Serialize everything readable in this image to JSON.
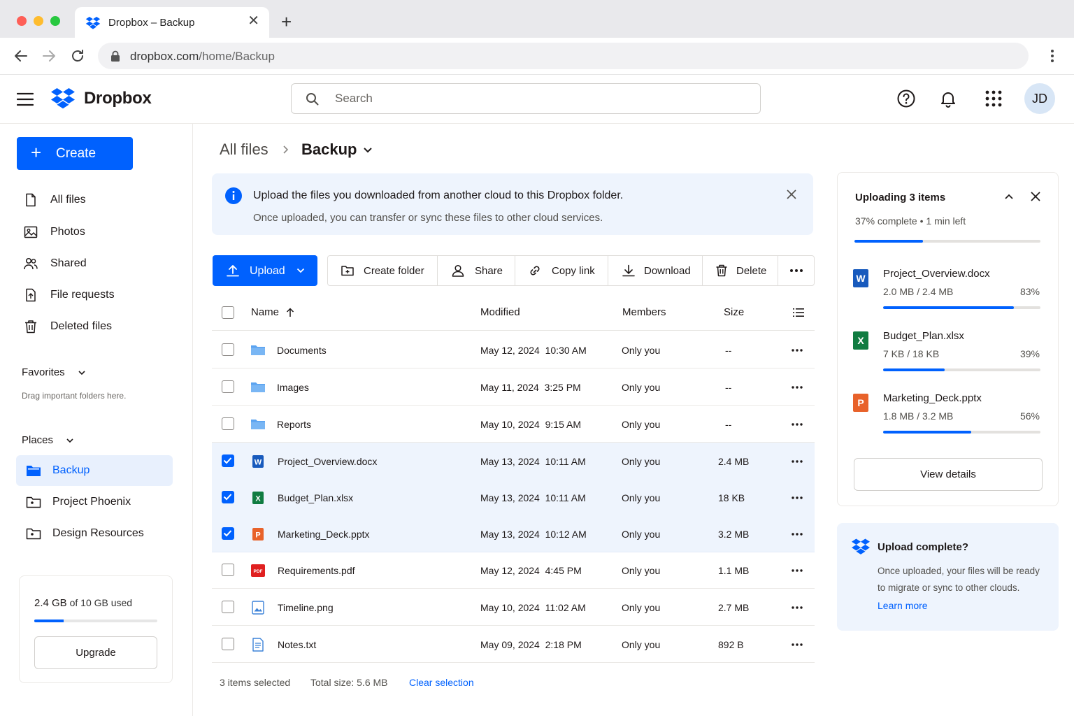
{
  "browser": {
    "tab_title": "Dropbox – Backup",
    "url_domain": "dropbox.com",
    "url_path": "/home/Backup"
  },
  "header": {
    "brand": "Dropbox",
    "search_placeholder": "Search",
    "avatar_initials": "JD"
  },
  "sidebar": {
    "create_label": "Create",
    "nav": [
      {
        "label": "All files",
        "icon": "file-icon"
      },
      {
        "label": "Photos",
        "icon": "photo-icon"
      },
      {
        "label": "Shared",
        "icon": "people-icon"
      },
      {
        "label": "File requests",
        "icon": "file-request-icon"
      },
      {
        "label": "Deleted files",
        "icon": "trash-icon"
      }
    ],
    "favorites_label": "Favorites",
    "favorites_hint": "Drag important folders here.",
    "places_label": "Places",
    "places": [
      {
        "label": "Backup",
        "active": true
      },
      {
        "label": "Project Phoenix",
        "active": false
      },
      {
        "label": "Design Resources",
        "active": false
      }
    ],
    "storage": {
      "used": "2.4 GB",
      "rest": "of 10 GB used",
      "fraction": 0.24,
      "upgrade_label": "Upgrade"
    }
  },
  "breadcrumb": {
    "root": "All files",
    "current": "Backup"
  },
  "banner": {
    "title": "Upload the files you downloaded from another cloud to this Dropbox folder.",
    "body": "Once uploaded, you can transfer or sync these files to other cloud services."
  },
  "toolbar": {
    "upload": "Upload",
    "create_folder": "Create folder",
    "share": "Share",
    "copy_link": "Copy link",
    "download": "Download",
    "delete": "Delete"
  },
  "table": {
    "columns": {
      "name": "Name",
      "modified": "Modified",
      "members": "Members",
      "size": "Size"
    },
    "rows": [
      {
        "name": "Documents",
        "type": "folder",
        "modified": "May 12, 2024  10:30 AM",
        "members": "Only you",
        "size": "--",
        "selected": false
      },
      {
        "name": "Images",
        "type": "folder",
        "modified": "May 11, 2024  3:25 PM",
        "members": "Only you",
        "size": "--",
        "selected": false
      },
      {
        "name": "Reports",
        "type": "folder",
        "modified": "May 10, 2024  9:15 AM",
        "members": "Only you",
        "size": "--",
        "selected": false
      },
      {
        "name": "Project_Overview.docx",
        "type": "word",
        "modified": "May 13, 2024  10:11 AM",
        "members": "Only you",
        "size": "2.4 MB",
        "selected": true
      },
      {
        "name": "Budget_Plan.xlsx",
        "type": "excel",
        "modified": "May 13, 2024  10:11 AM",
        "members": "Only you",
        "size": "18 KB",
        "selected": true
      },
      {
        "name": "Marketing_Deck.pptx",
        "type": "powerpoint",
        "modified": "May 13, 2024  10:12 AM",
        "members": "Only you",
        "size": "3.2 MB",
        "selected": true
      },
      {
        "name": "Requirements.pdf",
        "type": "pdf",
        "modified": "May 12, 2024  4:45 PM",
        "members": "Only you",
        "size": "1.1 MB",
        "selected": false
      },
      {
        "name": "Timeline.png",
        "type": "image",
        "modified": "May 10, 2024  11:02 AM",
        "members": "Only you",
        "size": "2.7 MB",
        "selected": false
      },
      {
        "name": "Notes.txt",
        "type": "text",
        "modified": "May 09, 2024  2:18 PM",
        "members": "Only you",
        "size": "892 B",
        "selected": false
      }
    ]
  },
  "footer": {
    "selected": "3 items selected",
    "total": "Total size:  5.6 MB",
    "clear": "Clear selection"
  },
  "upload_panel": {
    "title": "Uploading 3 items",
    "status": "37% complete  •  1 min left",
    "progress": 0.37,
    "items": [
      {
        "letter": "W",
        "color": "#185abd",
        "name": "Project_Overview.docx",
        "size": "2.0 MB / 2.4 MB",
        "pct": "83%",
        "progress": 0.83
      },
      {
        "letter": "X",
        "color": "#107c41",
        "name": "Budget_Plan.xlsx",
        "size": "7 KB / 18 KB",
        "pct": "39%",
        "progress": 0.39
      },
      {
        "letter": "P",
        "color": "#e8622a",
        "name": "Marketing_Deck.pptx",
        "size": "1.8 MB / 3.2 MB",
        "pct": "56%",
        "progress": 0.56
      }
    ],
    "view_details": "View details"
  },
  "info_card": {
    "title": "Upload complete?",
    "body": "Once uploaded, your files will be ready to migrate or sync to other clouds.",
    "link": "Learn more"
  },
  "colors": {
    "accent": "#0061fe",
    "selected_bg": "#eef4fd",
    "folder": "#5aa3f0"
  }
}
